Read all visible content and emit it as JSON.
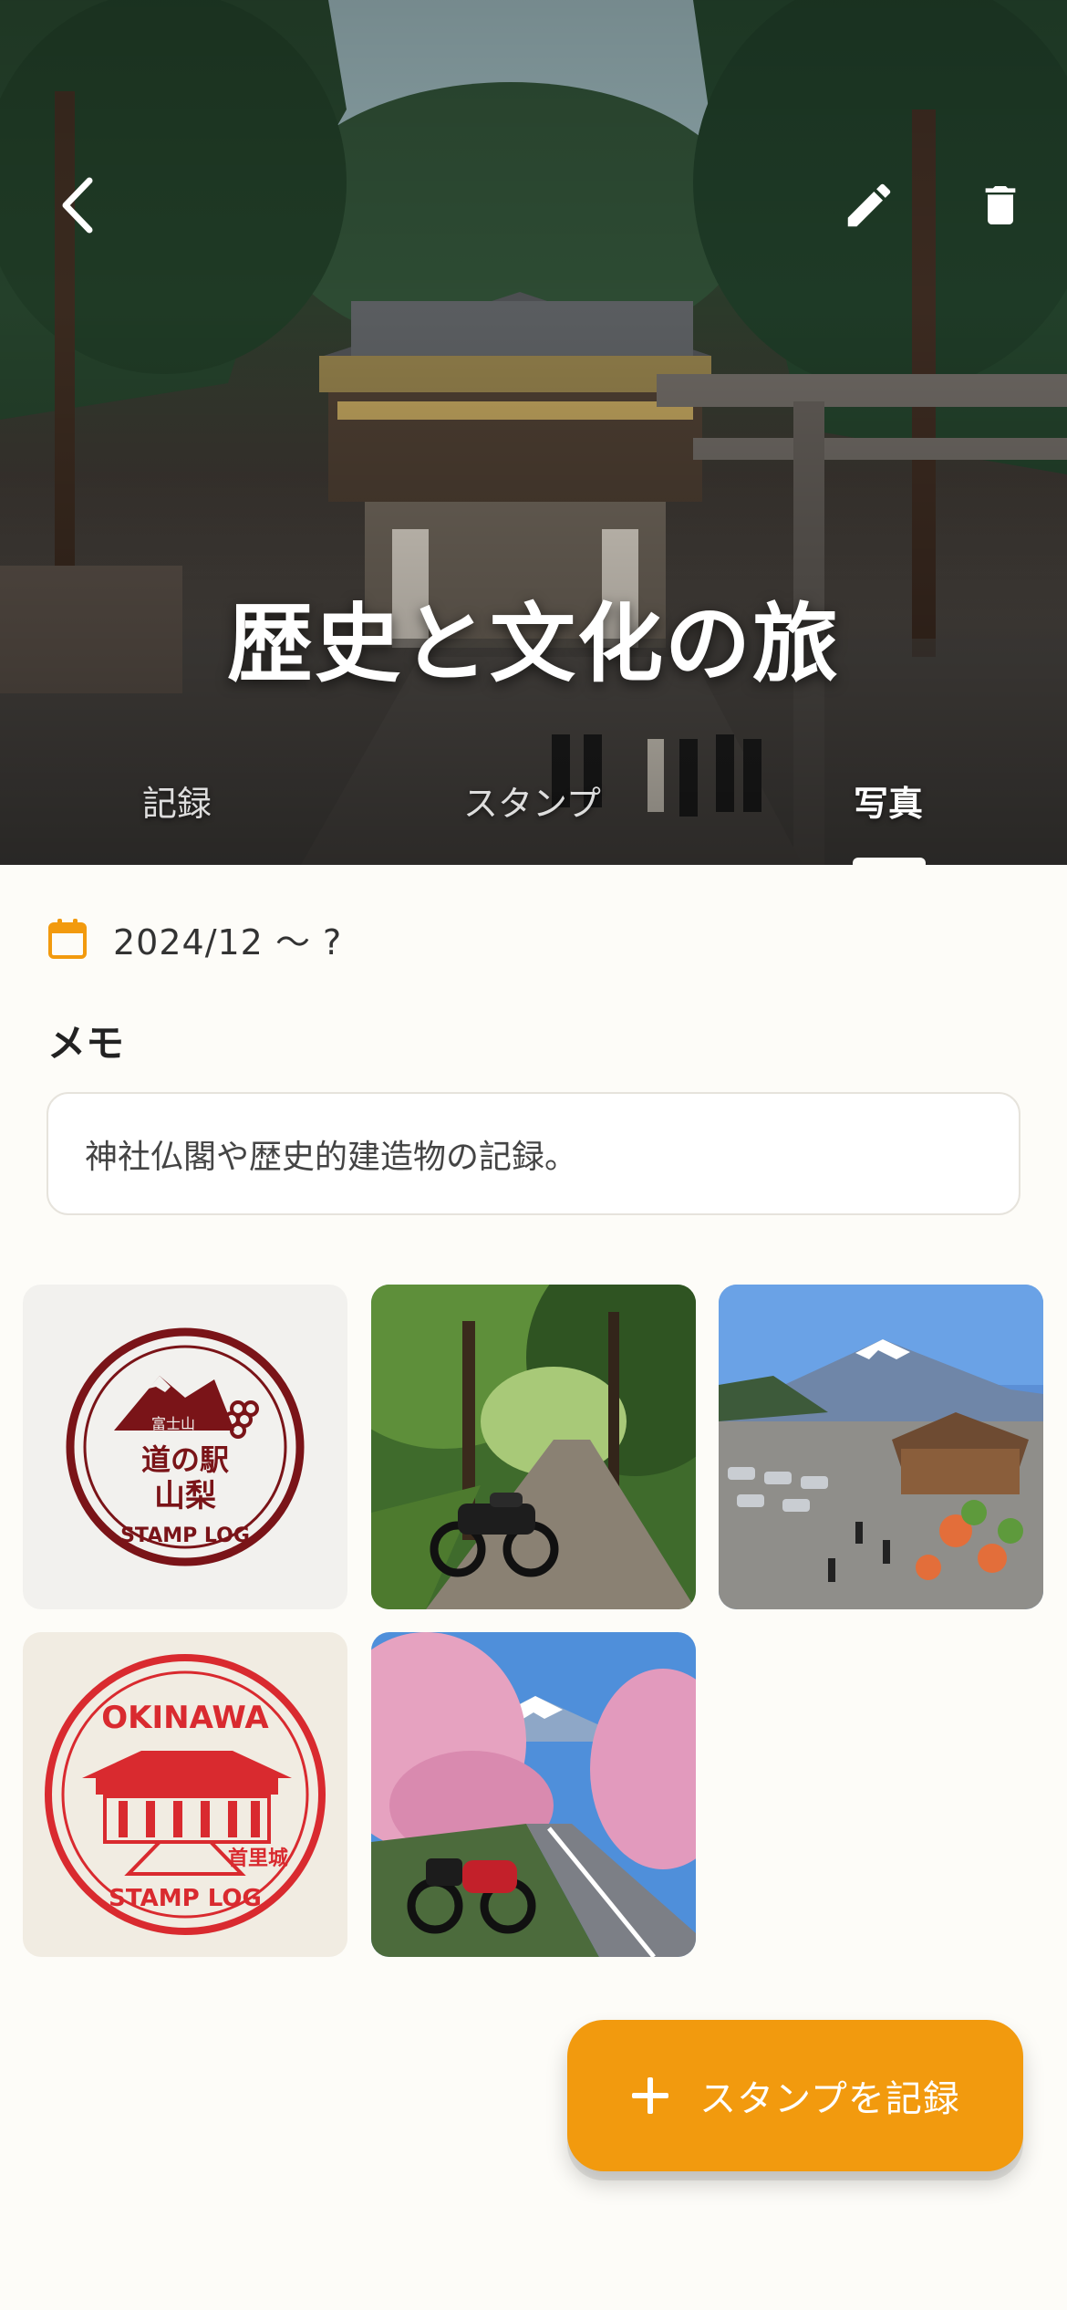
{
  "header": {
    "title": "歴史と文化の旅",
    "back_icon": "chevron-left-icon",
    "edit_icon": "pencil-icon",
    "delete_icon": "trash-icon"
  },
  "tabs": [
    {
      "label": "記録",
      "active": false
    },
    {
      "label": "スタンプ",
      "active": false
    },
    {
      "label": "写真",
      "active": true
    }
  ],
  "details": {
    "date_icon": "calendar-icon",
    "date_range": "2024/12 〜 ?",
    "memo_label": "メモ",
    "memo_text": "神社仏閣や歴史的建造物の記録。"
  },
  "photos": {
    "stamp_fuji": {
      "top_text": "富士山",
      "main_line1": "道の駅",
      "main_line2": "山梨",
      "bottom_text": "STAMP LOG"
    },
    "stamp_okinawa": {
      "top_text": "OKINAWA",
      "badge_text": "首里城",
      "bottom_text": "STAMP LOG"
    }
  },
  "fab": {
    "icon": "plus-icon",
    "label": "スタンプを記録"
  },
  "colors": {
    "accent": "#f29a0e",
    "stamp_dark_red": "#7a1418",
    "stamp_red": "#d92a2f",
    "background": "#fdfcf8"
  }
}
